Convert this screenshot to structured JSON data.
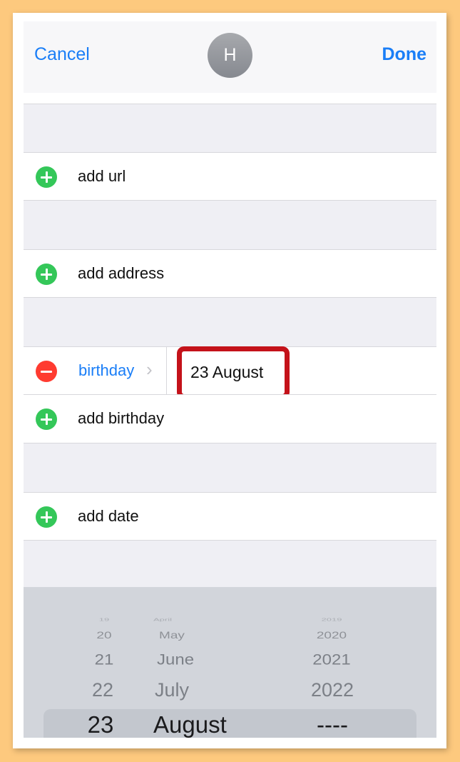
{
  "navbar": {
    "cancel_label": "Cancel",
    "done_label": "Done",
    "avatar_initial": "H"
  },
  "rows": {
    "url": "add url",
    "address": "add address",
    "birthday_label": "birthday",
    "birthday_value": "23 August",
    "add_birthday": "add birthday",
    "add_date": "add date"
  },
  "picker": {
    "days": [
      "19",
      "20",
      "21",
      "22",
      "23"
    ],
    "months": [
      "April",
      "May",
      "June",
      "July",
      "August"
    ],
    "years": [
      "2019",
      "2020",
      "2021",
      "2022",
      "----"
    ],
    "selected": {
      "day": "23",
      "month": "August",
      "year": "----"
    }
  },
  "colors": {
    "accent": "#1a7ef7",
    "add_green": "#34c759",
    "remove_red": "#ff3b30",
    "highlight_box": "#c4121a",
    "page_background": "#fdc97e"
  },
  "icons": [
    "plus-circle-icon",
    "minus-circle-icon",
    "chevron-right-icon"
  ]
}
